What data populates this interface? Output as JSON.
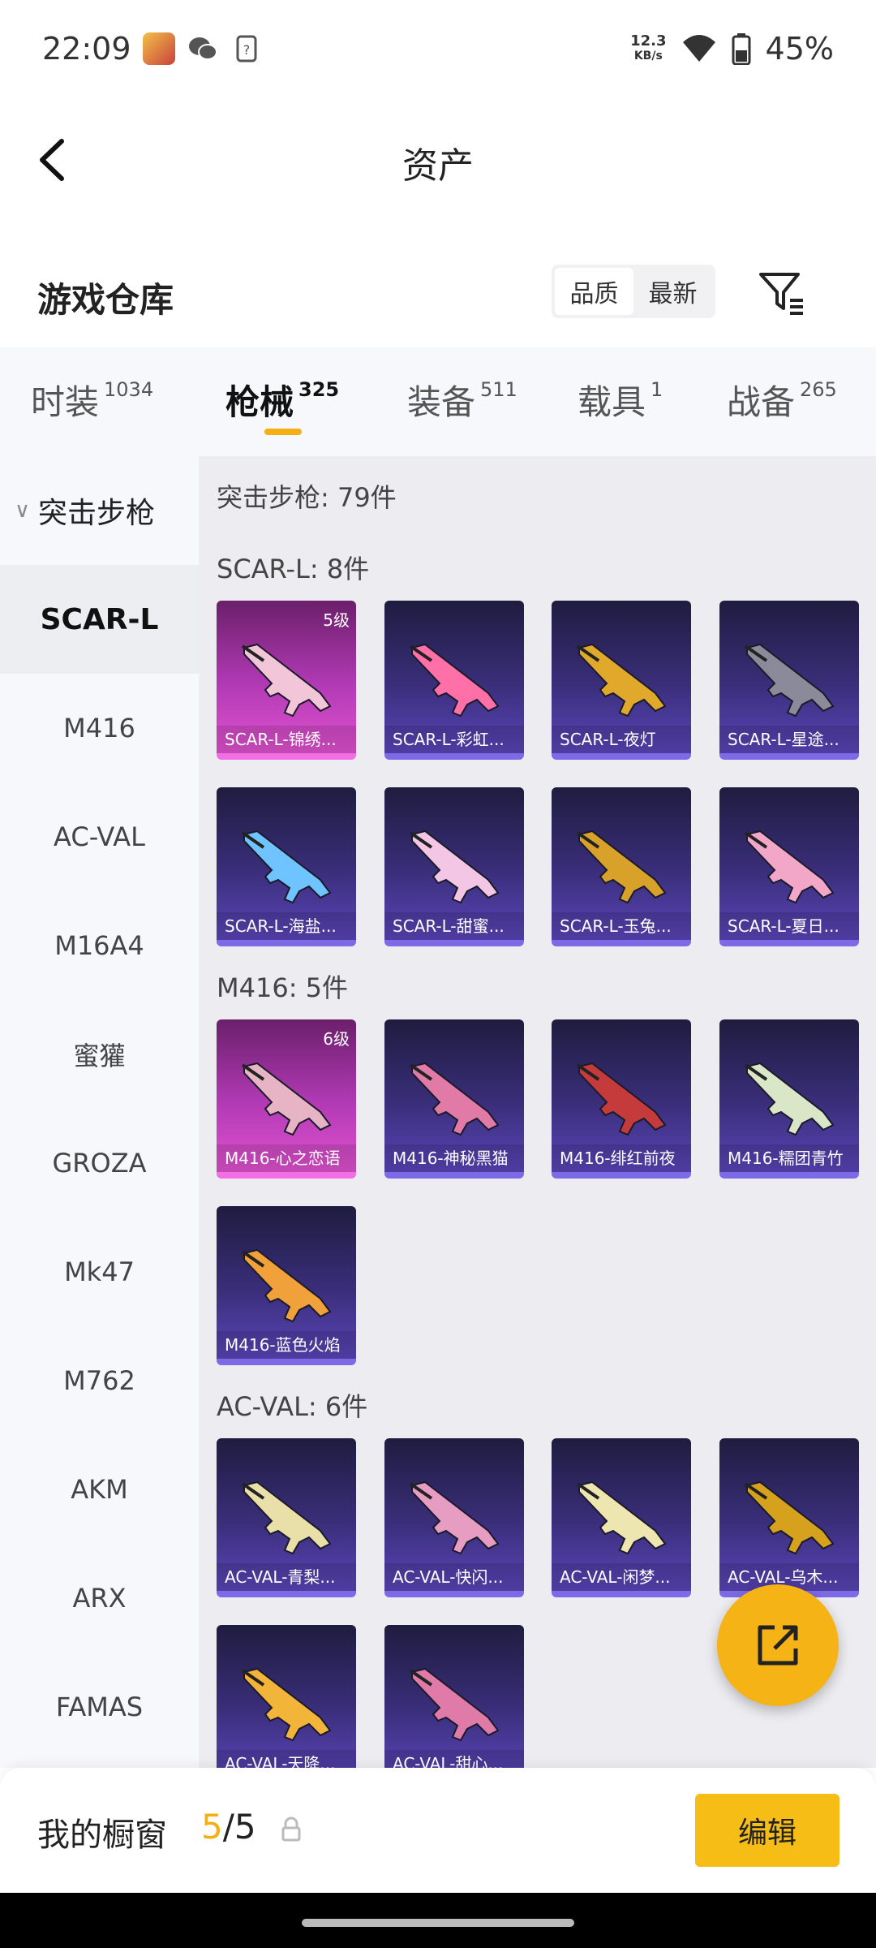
{
  "status_bar": {
    "time": "22:09",
    "net_speed_value": "12.3",
    "net_speed_unit": "KB/s",
    "battery": "45%",
    "icons": [
      "game-app-icon",
      "wechat-icon",
      "sim-icon",
      "wifi-icon",
      "battery-icon"
    ]
  },
  "header": {
    "title": "资产",
    "back_icon": "chevron-left-icon"
  },
  "section": {
    "title": "游戏仓库",
    "sort_options": [
      {
        "label": "品质",
        "active": true
      },
      {
        "label": "最新",
        "active": false
      }
    ],
    "filter_icon": "filter-icon"
  },
  "tabs": [
    {
      "label": "时装",
      "count": "1034",
      "active": false
    },
    {
      "label": "枪械",
      "count": "325",
      "active": true
    },
    {
      "label": "装备",
      "count": "511",
      "active": false
    },
    {
      "label": "载具",
      "count": "1",
      "active": false
    },
    {
      "label": "战备",
      "count": "265",
      "active": false
    }
  ],
  "sidebar": {
    "category": "突击步枪",
    "items": [
      {
        "label": "SCAR-L",
        "active": true
      },
      {
        "label": "M416",
        "active": false
      },
      {
        "label": "AC-VAL",
        "active": false
      },
      {
        "label": "M16A4",
        "active": false
      },
      {
        "label": "蜜獾",
        "active": false
      },
      {
        "label": "GROZA",
        "active": false
      },
      {
        "label": "Mk47",
        "active": false
      },
      {
        "label": "M762",
        "active": false
      },
      {
        "label": "AKM",
        "active": false
      },
      {
        "label": "ARX",
        "active": false
      },
      {
        "label": "FAMAS",
        "active": false
      }
    ]
  },
  "main": {
    "total": "突击步枪: 79件",
    "groups": [
      {
        "title": "SCAR-L: 8件",
        "items": [
          {
            "name": "SCAR-L-锦绣...",
            "level": "5级",
            "rarity": "pink",
            "accent": "#f2c6d8"
          },
          {
            "name": "SCAR-L-彩虹...",
            "level": "",
            "rarity": "purple",
            "accent": "#ff6fa8"
          },
          {
            "name": "SCAR-L-夜灯",
            "level": "",
            "rarity": "purple",
            "accent": "#e0a92b"
          },
          {
            "name": "SCAR-L-星途...",
            "level": "",
            "rarity": "purple",
            "accent": "#8a8a9a"
          },
          {
            "name": "SCAR-L-海盐...",
            "level": "",
            "rarity": "purple",
            "accent": "#6fc3ff"
          },
          {
            "name": "SCAR-L-甜蜜...",
            "level": "",
            "rarity": "purple",
            "accent": "#f4c6e6"
          },
          {
            "name": "SCAR-L-玉兔...",
            "level": "",
            "rarity": "purple",
            "accent": "#d7a12a"
          },
          {
            "name": "SCAR-L-夏日...",
            "level": "",
            "rarity": "purple",
            "accent": "#f2a7c9"
          }
        ]
      },
      {
        "title": "M416: 5件",
        "items": [
          {
            "name": "M416-心之恋语",
            "level": "6级",
            "rarity": "pink",
            "accent": "#e6b4c4"
          },
          {
            "name": "M416-神秘黑猫",
            "level": "",
            "rarity": "purple",
            "accent": "#e27aa8"
          },
          {
            "name": "M416-绯红前夜",
            "level": "",
            "rarity": "purple",
            "accent": "#c53a3a"
          },
          {
            "name": "M416-糯团青竹",
            "level": "",
            "rarity": "purple",
            "accent": "#d9e6c8"
          },
          {
            "name": "M416-蓝色火焰",
            "level": "",
            "rarity": "purple",
            "accent": "#f0a13a"
          }
        ]
      },
      {
        "title": "AC-VAL: 6件",
        "items": [
          {
            "name": "AC-VAL-青梨...",
            "level": "",
            "rarity": "purple",
            "accent": "#e8e0a8"
          },
          {
            "name": "AC-VAL-快闪...",
            "level": "",
            "rarity": "purple",
            "accent": "#e79cc2"
          },
          {
            "name": "AC-VAL-闲梦...",
            "level": "",
            "rarity": "purple",
            "accent": "#eee6b0"
          },
          {
            "name": "AC-VAL-乌木...",
            "level": "",
            "rarity": "purple",
            "accent": "#d6a11d"
          },
          {
            "name": "AC-VAL-天降...",
            "level": "",
            "rarity": "purple",
            "accent": "#f2b53a"
          },
          {
            "name": "AC-VAL-甜心...",
            "level": "",
            "rarity": "purple",
            "accent": "#e07aa8"
          }
        ]
      }
    ]
  },
  "fab": {
    "icon": "share-external-icon",
    "color": "#f6b315"
  },
  "bottom_bar": {
    "label": "我的橱窗",
    "current": "5",
    "separator": "/",
    "max": "5",
    "lock_icon": "lock-icon",
    "edit_label": "编辑"
  },
  "colors": {
    "accent": "#f4b012",
    "edit_button": "#f6bd16",
    "card_purple": "#5a45b8",
    "card_pink": "#e052cf"
  }
}
